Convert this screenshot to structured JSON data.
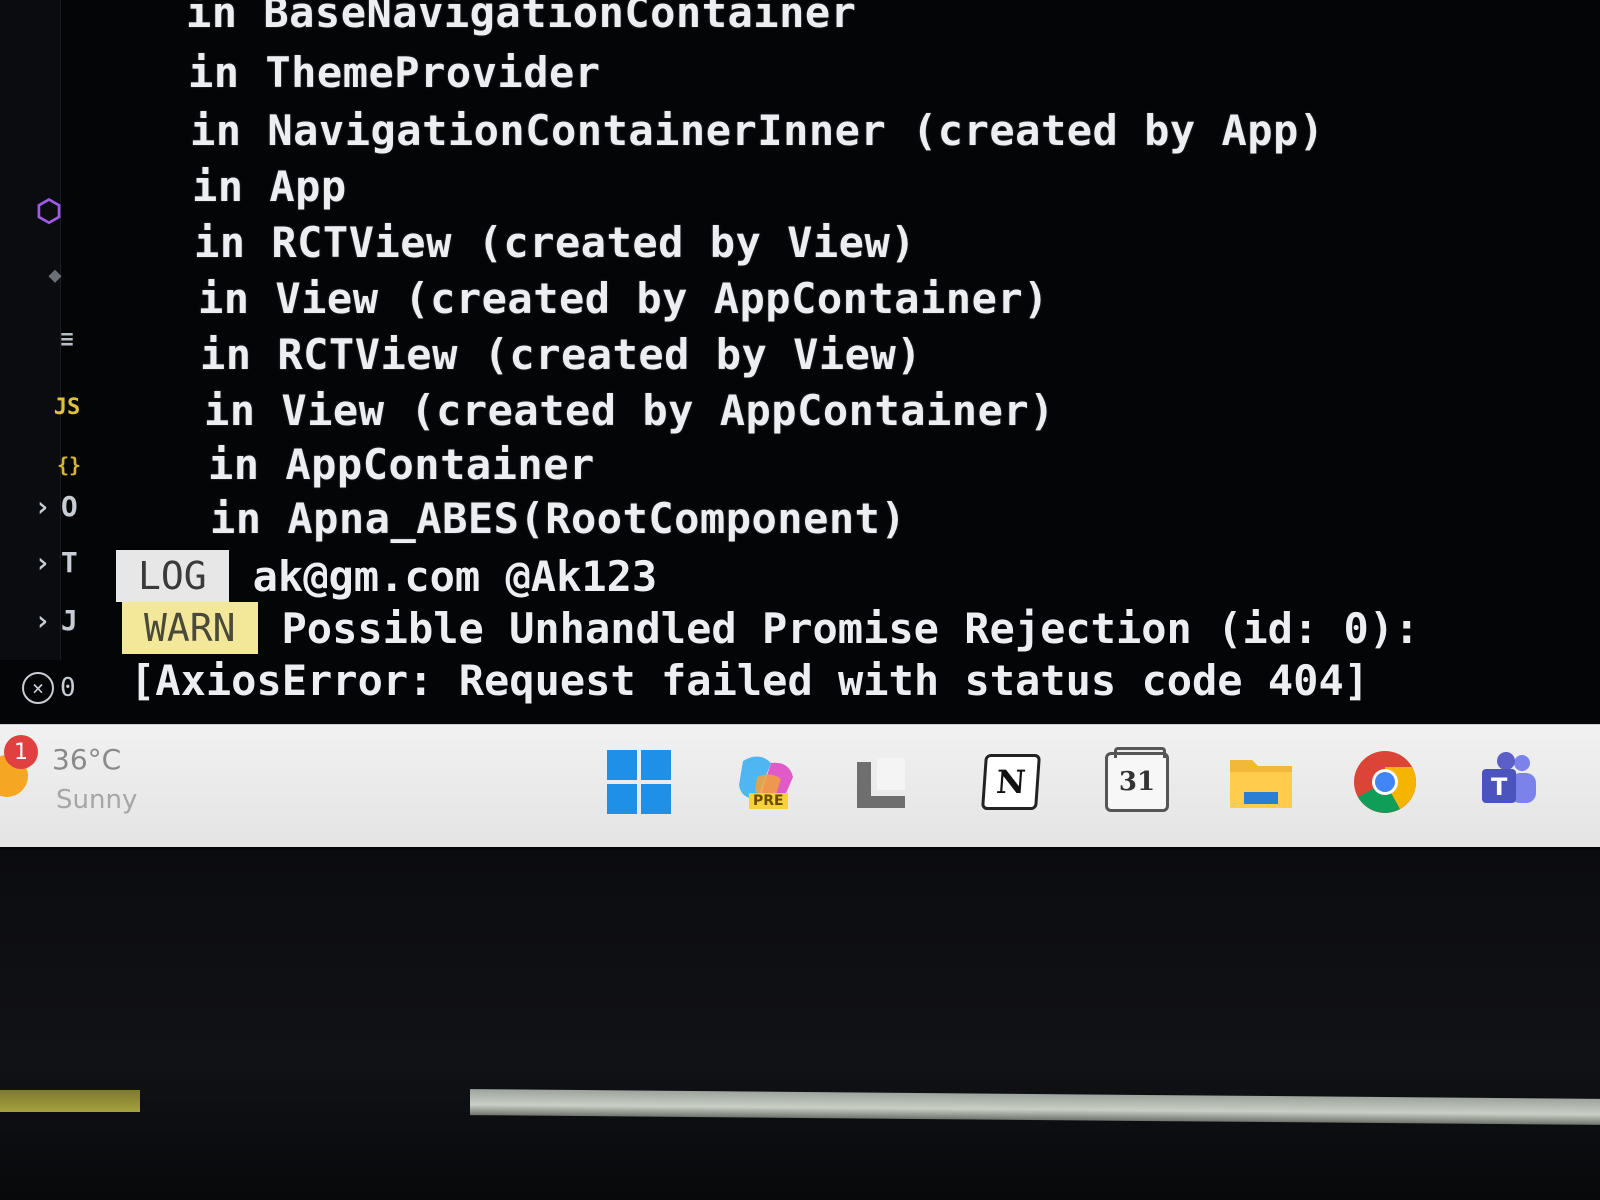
{
  "terminal": {
    "stack_trace": [
      "in BaseNavigationContainer",
      "in ThemeProvider",
      "in NavigationContainerInner (created by App)",
      "in App",
      "in RCTView (created by View)",
      "in View (created by AppContainer)",
      "in RCTView (created by View)",
      "in View (created by AppContainer)",
      "in AppContainer",
      "in Apna_ABES(RootComponent)"
    ],
    "log": {
      "badge": "LOG",
      "text": "ak@gm.com @Ak123",
      "badge_color": "#e7e7e7"
    },
    "warn": {
      "badge": "WARN",
      "text": "Possible Unhandled Promise Rejection (id: 0):",
      "badge_color": "#f3e79a"
    },
    "error_text": "[AxiosError: Request failed with status code 404]"
  },
  "sidebar": {
    "icons": [
      "extension-hexagon-icon",
      "source-control-icon",
      "outline-icon",
      "js-file-icon",
      "json-file-icon"
    ],
    "js_label": "JS",
    "braces_label": "{}",
    "tree_items": [
      {
        "label": "O"
      },
      {
        "label": "T"
      },
      {
        "label": "J"
      }
    ],
    "problems_count": "0"
  },
  "taskbar": {
    "weather": {
      "temp": "36°C",
      "condition": "Sunny",
      "notification_count": "1"
    },
    "apps": [
      {
        "name": "Start",
        "icon": "windows-logo-icon"
      },
      {
        "name": "Copilot PRE",
        "icon": "copilot-icon",
        "label": "PRE"
      },
      {
        "name": "Files",
        "icon": "files-app-icon"
      },
      {
        "name": "Notion",
        "icon": "notion-icon",
        "label": "N"
      },
      {
        "name": "Calendar",
        "icon": "calendar-icon",
        "label": "31"
      },
      {
        "name": "File Explorer",
        "icon": "folder-icon"
      },
      {
        "name": "Google Chrome",
        "icon": "chrome-icon"
      },
      {
        "name": "Microsoft Teams",
        "icon": "teams-icon",
        "label": "T"
      }
    ],
    "accent_color": "#1e90e8"
  }
}
